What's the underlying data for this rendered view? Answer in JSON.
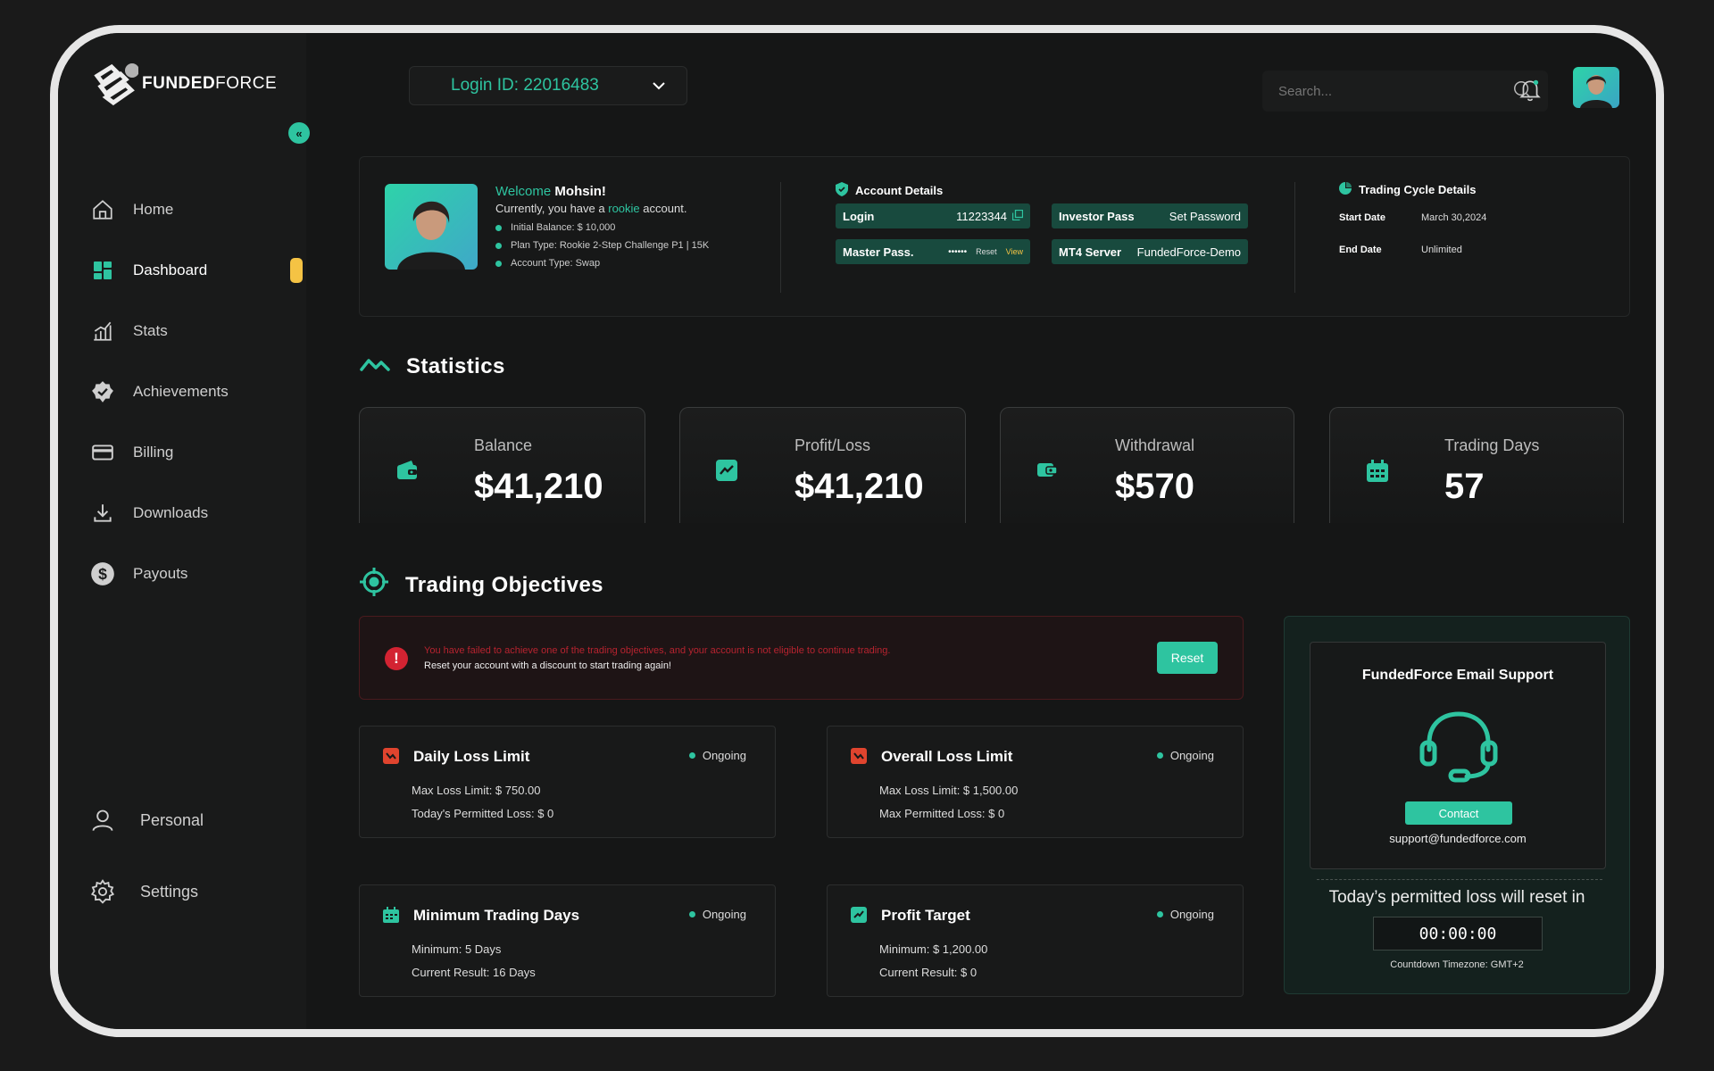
{
  "brand": {
    "logo_bold": "FUNDED",
    "logo_light": "FORCE",
    "accent": "#2ec4a0",
    "highlight": "#f5c344",
    "danger": "#d32332"
  },
  "sidebar": {
    "items": [
      {
        "label": "Home",
        "icon": "home-icon"
      },
      {
        "label": "Dashboard",
        "icon": "dashboard-icon",
        "active": true
      },
      {
        "label": "Stats",
        "icon": "stats-icon"
      },
      {
        "label": "Achievements",
        "icon": "achievement-badge-icon"
      },
      {
        "label": "Billing",
        "icon": "card-icon"
      },
      {
        "label": "Downloads",
        "icon": "download-icon"
      },
      {
        "label": "Payouts",
        "icon": "dollar-icon"
      }
    ],
    "bottom": [
      {
        "label": "Personal",
        "icon": "user-icon"
      },
      {
        "label": "Settings",
        "icon": "gear-icon"
      }
    ]
  },
  "header": {
    "login_id": "Login ID: 22016483",
    "search_placeholder": "Search..."
  },
  "welcome": {
    "greeting": "Welcome",
    "name": "Mohsin!",
    "line_pre": "Currently, you have a",
    "plan": "rookie",
    "line_post": "account.",
    "details": [
      "Initial Balance: $ 10,000",
      "Plan Type: Rookie 2-Step Challenge P1 | 15K",
      "Account Type: Swap"
    ]
  },
  "account": {
    "title": "Account Details",
    "login_label": "Login",
    "login_value": "11223344",
    "investor_label": "Investor Pass",
    "investor_value": "Set Password",
    "master_label": "Master Pass.",
    "master_value": "••••••",
    "master_reset": "Reset",
    "master_view": "View",
    "server_label": "MT4 Server",
    "server_value": "FundedForce-Demo"
  },
  "trading_cycle": {
    "title": "Trading Cycle Details",
    "start_label": "Start Date",
    "start_value": "March 30,2024",
    "end_label": "End Date",
    "end_value": "Unlimited"
  },
  "statistics": {
    "title": "Statistics",
    "cards": [
      {
        "label": "Balance",
        "value": "$41,210",
        "icon": "wallet-icon"
      },
      {
        "label": "Profit/Loss",
        "value": "$41,210",
        "icon": "trend-icon"
      },
      {
        "label": "Withdrawal",
        "value": "$570",
        "icon": "withdraw-wallet-icon"
      },
      {
        "label": "Trading Days",
        "value": "57",
        "icon": "calendar-icon"
      }
    ]
  },
  "objectives": {
    "title": "Trading Objectives",
    "alert_line1": "You have failed to achieve one of the trading objectives, and your account is not eligible to continue trading.",
    "alert_line2": "Reset your account with a discount to start trading again!",
    "reset_label": "Reset",
    "items": [
      {
        "title": "Daily Loss Limit",
        "status": "Ongoing",
        "l1": "Max Loss Limit: $ 750.00",
        "l2": "Today's Permitted Loss: $ 0"
      },
      {
        "title": "Overall Loss Limit",
        "status": "Ongoing",
        "l1": "Max Loss Limit: $ 1,500.00",
        "l2": "Max Permitted Loss: $ 0"
      },
      {
        "title": "Minimum Trading Days",
        "status": "Ongoing",
        "l1": "Minimum: 5 Days",
        "l2": "Current Result: 16 Days"
      },
      {
        "title": "Profit Target",
        "status": "Ongoing",
        "l1": "Minimum: $ 1,200.00",
        "l2": "Current Result: $ 0"
      }
    ]
  },
  "support": {
    "title": "FundedForce Email Support",
    "contact_label": "Contact",
    "email": "support@fundedforce.com",
    "reset_text": "Today’s permitted loss will reset in",
    "timer": "00:00:00",
    "timezone": "Countdown Timezone: GMT+2"
  }
}
